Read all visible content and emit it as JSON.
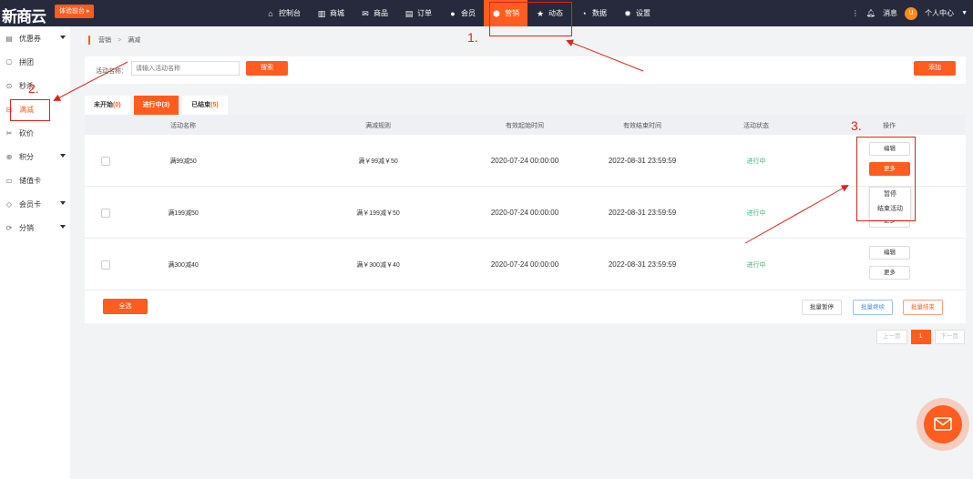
{
  "header": {
    "logo": "新商云",
    "trial_button": "体验前台 ▸",
    "nav": [
      {
        "label": "控制台",
        "icon": "home-icon",
        "glyph": "⌂"
      },
      {
        "label": "商城",
        "icon": "shop-icon",
        "glyph": "▥"
      },
      {
        "label": "商品",
        "icon": "goods-icon",
        "glyph": "✉"
      },
      {
        "label": "订单",
        "icon": "order-icon",
        "glyph": "▤"
      },
      {
        "label": "会员",
        "icon": "member-icon",
        "glyph": "●"
      },
      {
        "label": "营销",
        "icon": "marketing-icon",
        "glyph": "⬢"
      },
      {
        "label": "动态",
        "icon": "star-icon",
        "glyph": "★"
      },
      {
        "label": "数据",
        "icon": "pie-chart-icon",
        "glyph": "◔"
      },
      {
        "label": "设置",
        "icon": "gear-icon",
        "glyph": "✹"
      }
    ],
    "active_nav": "营销",
    "messages_label": "消息",
    "user_label": "个人中心",
    "avatar_text": "U"
  },
  "sidebar": {
    "items": [
      {
        "label": "优惠券",
        "glyph": "▤",
        "icon": "coupon-icon",
        "has_caret": true
      },
      {
        "label": "拼团",
        "glyph": "⎔",
        "icon": "group-buy-icon",
        "has_caret": false
      },
      {
        "label": "秒杀",
        "glyph": "⊙",
        "icon": "flash-sale-icon",
        "has_caret": false
      },
      {
        "label": "满减",
        "glyph": "⊟",
        "icon": "discount-icon",
        "has_caret": false
      },
      {
        "label": "砍价",
        "glyph": "✂",
        "icon": "bargain-icon",
        "has_caret": false
      },
      {
        "label": "积分",
        "glyph": "⊕",
        "icon": "points-icon",
        "has_caret": true
      },
      {
        "label": "储值卡",
        "glyph": "▭",
        "icon": "stored-card-icon",
        "has_caret": false
      },
      {
        "label": "会员卡",
        "glyph": "◇",
        "icon": "member-card-icon",
        "has_caret": true
      },
      {
        "label": "分销",
        "glyph": "⟳",
        "icon": "distribution-icon",
        "has_caret": true
      }
    ],
    "active_item": "满减"
  },
  "breadcrumb": {
    "root": "营销",
    "separator": ">",
    "current": "满减"
  },
  "filter": {
    "label": "活动名称：",
    "placeholder": "请输入活动名称",
    "search_button": "搜索",
    "add_button": "添加"
  },
  "tabs": [
    {
      "label": "未开始",
      "count": "(0)",
      "active": false
    },
    {
      "label": "进行中",
      "count": "(3)",
      "active": true
    },
    {
      "label": "已结束",
      "count": "(5)",
      "active": false
    }
  ],
  "table": {
    "columns": [
      "活动名称",
      "满减规则",
      "有效起始时间",
      "有效结束时间",
      "活动状态",
      "操作"
    ],
    "rows": [
      {
        "name": "满99减50",
        "rule": "满￥99减￥50",
        "start": "2020-07-24 00:00:00",
        "end": "2022-08-31 23:59:59",
        "status": "进行中"
      },
      {
        "name": "满199减50",
        "rule": "满￥199减￥50",
        "start": "2020-07-24 00:00:00",
        "end": "2022-08-31 23:59:59",
        "status": "进行中"
      },
      {
        "name": "满300减40",
        "rule": "满￥300减￥40",
        "start": "2020-07-24 00:00:00",
        "end": "2022-08-31 23:59:59",
        "status": "进行中"
      }
    ],
    "edit_label": "编辑",
    "more_label": "更多",
    "dropdown": [
      "暂停",
      "结束活动"
    ]
  },
  "footer": {
    "select_all": "全选",
    "batch_pause": "批量暂停",
    "batch_resume": "批量继续",
    "batch_end": "批量结束"
  },
  "pagination": {
    "prev": "上一页",
    "current": "1",
    "next": "下一页"
  },
  "annotations": [
    "1.",
    "2.",
    "3."
  ],
  "colors": {
    "accent": "#ff5c1f",
    "header_bg": "#262a3c",
    "status_green": "#3cb371",
    "annotation_red": "#d9261c"
  }
}
